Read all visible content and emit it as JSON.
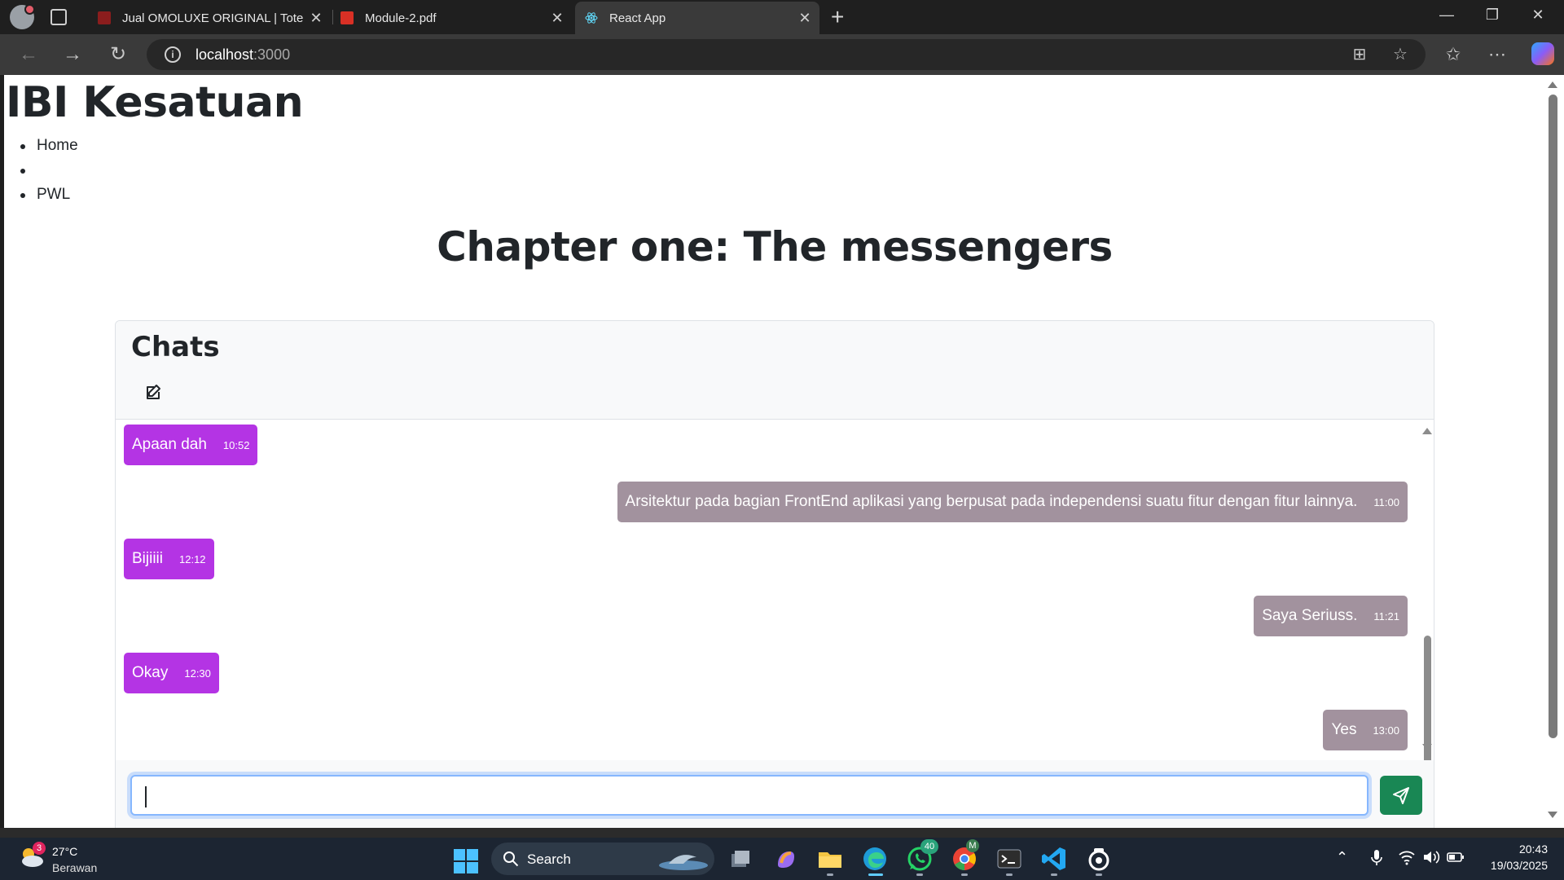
{
  "browser": {
    "tabs": [
      {
        "title": "Jual OMOLUXE ORIGINAL | Tote Ba",
        "close": "✕"
      },
      {
        "title": "Module-2.pdf",
        "close": "✕"
      },
      {
        "title": "React App",
        "close": "✕"
      }
    ],
    "new_tab": "+",
    "window": {
      "minimize": "—",
      "maximize": "❐",
      "close": "✕"
    },
    "url_host": "localhost",
    "url_port": ":3000"
  },
  "page": {
    "site_title": "IBI Kesatuan",
    "nav": [
      "Home",
      "",
      "PWL"
    ],
    "chapter_title": "Chapter one: The messengers"
  },
  "chat": {
    "title": "Chats",
    "input_value": "",
    "messages": [
      {
        "side": "left",
        "text": "Apaan dah",
        "time": "10:52"
      },
      {
        "side": "right",
        "text": "Arsitektur pada bagian FrontEnd aplikasi yang berpusat pada independensi suatu fitur dengan fitur lainnya.",
        "time": "11:00"
      },
      {
        "side": "left",
        "text": "Bijiiii",
        "time": "12:12"
      },
      {
        "side": "right",
        "text": "Saya Seriuss.",
        "time": "11:21"
      },
      {
        "side": "left",
        "text": "Okay",
        "time": "12:30"
      },
      {
        "side": "right",
        "text": "Yes",
        "time": "13:00"
      }
    ]
  },
  "taskbar": {
    "weather_badge": "3",
    "weather_temp": "27°C",
    "weather_desc": "Berawan",
    "search_label": "Search",
    "whatsapp_badge": "40",
    "chrome_badge": "M",
    "clock_time": "20:43",
    "clock_date": "19/03/2025"
  },
  "colors": {
    "received_bubble": "#b434e4",
    "sent_bubble": "#a2929e",
    "send_button": "#198754",
    "input_focus": "#86b7fe"
  }
}
